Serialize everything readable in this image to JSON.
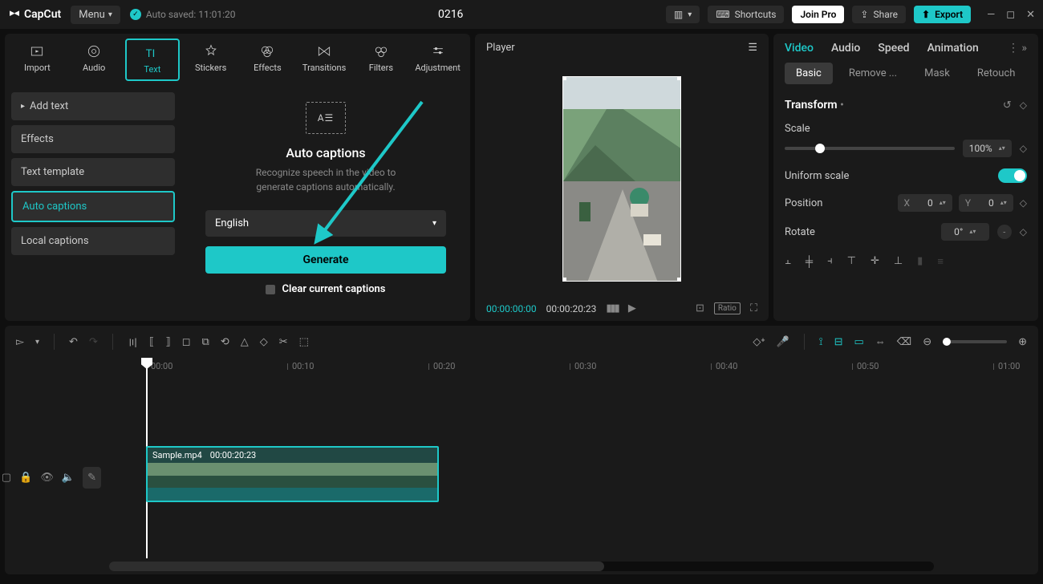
{
  "titlebar": {
    "app_name": "CapCut",
    "menu_label": "Menu",
    "autosave_label": "Auto saved: 11:01:20",
    "project_name": "0216",
    "layout_label": "",
    "shortcuts_label": "Shortcuts",
    "joinpro_label": "Join Pro",
    "share_label": "Share",
    "export_label": "Export"
  },
  "media_tabs": {
    "import": "Import",
    "audio": "Audio",
    "text": "Text",
    "stickers": "Stickers",
    "effects": "Effects",
    "transitions": "Transitions",
    "filters": "Filters",
    "adjustment": "Adjustment"
  },
  "sidebar": {
    "add_text": "Add text",
    "effects": "Effects",
    "text_template": "Text template",
    "auto_captions": "Auto captions",
    "local_captions": "Local captions"
  },
  "auto_captions": {
    "frame_glyph": "A☰",
    "title": "Auto captions",
    "desc1": "Recognize speech in the video to",
    "desc2": "generate captions automatically.",
    "language": "English",
    "generate": "Generate",
    "clear": "Clear current captions"
  },
  "player": {
    "title": "Player",
    "time_current": "00:00:00:00",
    "time_duration": "00:00:20:23",
    "ratio_label": "Ratio"
  },
  "right_panel": {
    "tabs": {
      "video": "Video",
      "audio": "Audio",
      "speed": "Speed",
      "animation": "Animation"
    },
    "subtabs": {
      "basic": "Basic",
      "remove_bg": "Remove ...",
      "mask": "Mask",
      "retouch": "Retouch"
    },
    "transform_label": "Transform",
    "scale_label": "Scale",
    "scale_value": "100%",
    "uniform_label": "Uniform scale",
    "position_label": "Position",
    "x_label": "X",
    "x_value": "0",
    "y_label": "Y",
    "y_value": "0",
    "rotate_label": "Rotate",
    "rotate_value": "0°"
  },
  "timeline": {
    "ticks": [
      "00:00",
      "00:10",
      "00:20",
      "00:30",
      "00:40",
      "00:50",
      "01:00"
    ],
    "clip_name": "Sample.mp4",
    "clip_duration": "00:00:20:23"
  }
}
